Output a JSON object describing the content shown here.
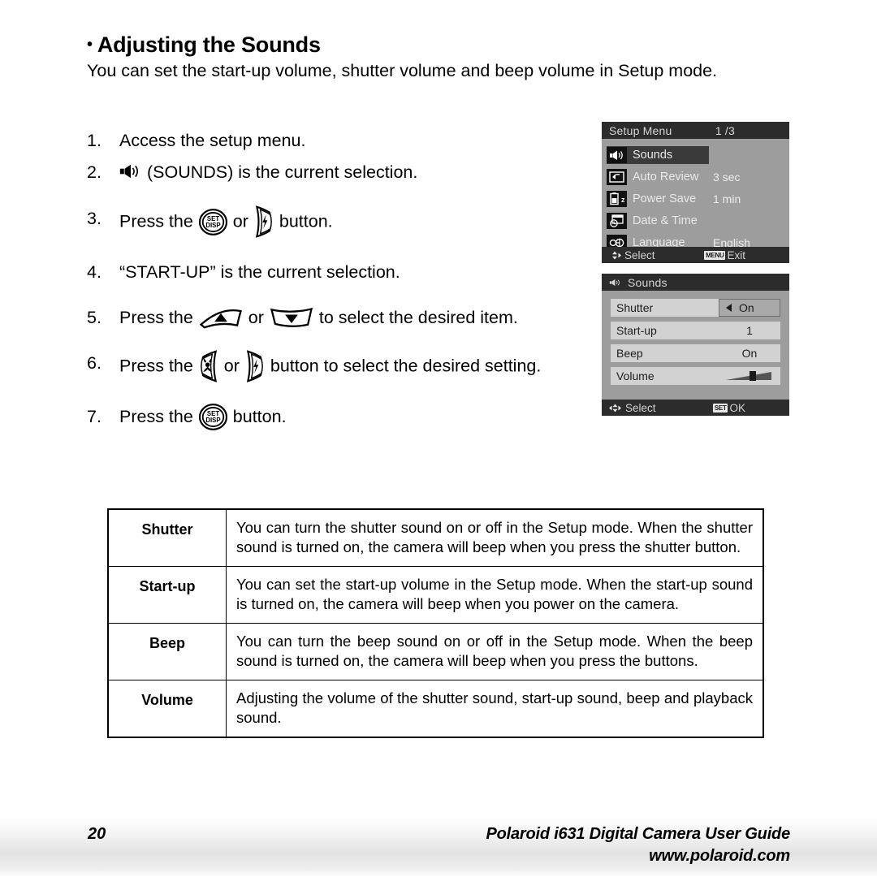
{
  "heading": {
    "bullet": "•",
    "title": "Adjusting the Sounds"
  },
  "intro": "You can set the start-up volume, shutter volume and beep volume in Setup mode.",
  "steps": [
    {
      "num": "1.",
      "text": "Access the setup menu."
    },
    {
      "num": "2.",
      "pre": "",
      "post": "(SOUNDS) is the current selection.",
      "icon": "speaker-icon"
    },
    {
      "num": "3.",
      "pre": "Press the",
      "mid": "or",
      "post": "button."
    },
    {
      "num": "4.",
      "text": "“START-UP” is the current selection."
    },
    {
      "num": "5.",
      "pre": "Press the",
      "mid": "or",
      "post": "to select the desired item."
    },
    {
      "num": "6.",
      "pre": "Press the",
      "mid": "or",
      "post": "button to select the desired setting."
    },
    {
      "num": "7.",
      "pre": "Press the",
      "post": "button."
    }
  ],
  "buttons": {
    "set_top": "SET",
    "set_bottom": "DISP"
  },
  "setup_menu": {
    "title": "Setup Menu",
    "page": "1 /3",
    "items": [
      {
        "icon": "speaker-icon",
        "label": "Sounds",
        "value": "",
        "selected": true
      },
      {
        "icon": "auto-review-icon",
        "label": "Auto Review",
        "value": "3 sec",
        "selected": false
      },
      {
        "icon": "power-save-icon",
        "label": "Power Save",
        "value": "1 min",
        "selected": false
      },
      {
        "icon": "date-time-icon",
        "label": "Date & Time",
        "value": "",
        "selected": false
      },
      {
        "icon": "language-icon",
        "label": "Language",
        "value": "English",
        "selected": false
      }
    ],
    "footer": {
      "select_label": "Select",
      "badge": "MENU",
      "exit_label": "Exit"
    }
  },
  "sounds_menu": {
    "title": "Sounds",
    "rows": [
      {
        "label": "Shutter",
        "value": "On",
        "active": true,
        "type": "value"
      },
      {
        "label": "Start-up",
        "value": "1",
        "active": false,
        "type": "value"
      },
      {
        "label": "Beep",
        "value": "On",
        "active": false,
        "type": "value"
      },
      {
        "label": "Volume",
        "value": "",
        "active": false,
        "type": "slider",
        "level": 65
      }
    ],
    "footer": {
      "select_label": "Select",
      "badge": "SET",
      "ok_label": "OK"
    }
  },
  "description_table": {
    "rows": [
      {
        "term": "Shutter",
        "definition": "You can turn the shutter sound on or off in the Setup mode. When the shutter sound is turned on, the camera will beep when you press the shutter button."
      },
      {
        "term": "Start-up",
        "definition": "You can set the start-up volume in the Setup mode. When the start-up sound is turned on, the camera will beep when you power on the camera."
      },
      {
        "term": "Beep",
        "definition": "You can turn the beep sound on or off in the Setup mode. When the beep sound is turned on, the camera will beep when you press the buttons."
      },
      {
        "term": "Volume",
        "definition": "Adjusting the volume of the shutter sound, start-up sound, beep and playback sound."
      }
    ]
  },
  "page_footer": {
    "page_number": "20",
    "guide_title": "Polaroid i631 Digital Camera User Guide",
    "website": "www.polaroid.com"
  }
}
